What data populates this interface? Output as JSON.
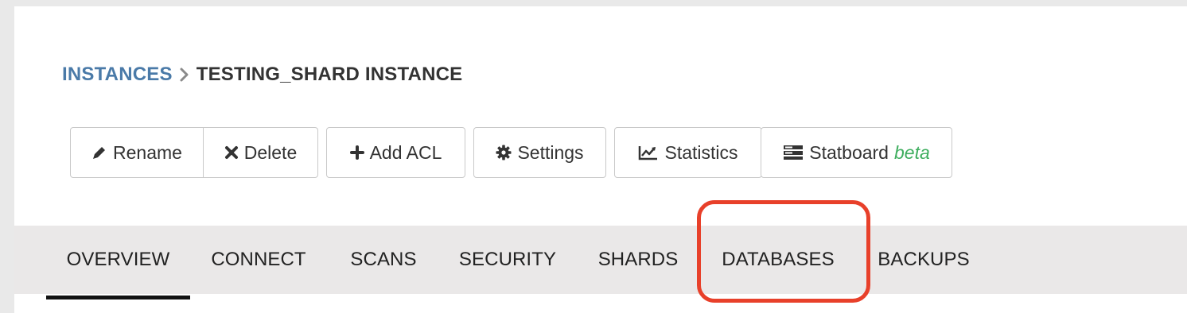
{
  "breadcrumb": {
    "parent": "INSTANCES",
    "current": "TESTING_SHARD INSTANCE",
    "separator_icon": "chevron-right-icon"
  },
  "toolbar": {
    "rename": {
      "label": "Rename",
      "icon": "pencil-icon"
    },
    "delete": {
      "label": "Delete",
      "icon": "x-icon"
    },
    "add_acl": {
      "label": "Add ACL",
      "icon": "plus-icon"
    },
    "settings": {
      "label": "Settings",
      "icon": "gear-icon"
    },
    "statistics": {
      "label": "Statistics",
      "icon": "line-chart-icon"
    },
    "statboard": {
      "label": "Statboard",
      "badge": "beta",
      "icon": "server-icon"
    }
  },
  "tabs": [
    {
      "label": "OVERVIEW",
      "active": true
    },
    {
      "label": "CONNECT",
      "active": false
    },
    {
      "label": "SCANS",
      "active": false
    },
    {
      "label": "SECURITY",
      "active": false
    },
    {
      "label": "SHARDS",
      "active": false
    },
    {
      "label": "DATABASES",
      "active": false,
      "highlighted": true
    },
    {
      "label": "BACKUPS",
      "active": false
    }
  ],
  "colors": {
    "link": "#4a7aa8",
    "beta": "#3fae5f",
    "highlight": "#e8402a",
    "tabbar": "#eae8e8"
  }
}
